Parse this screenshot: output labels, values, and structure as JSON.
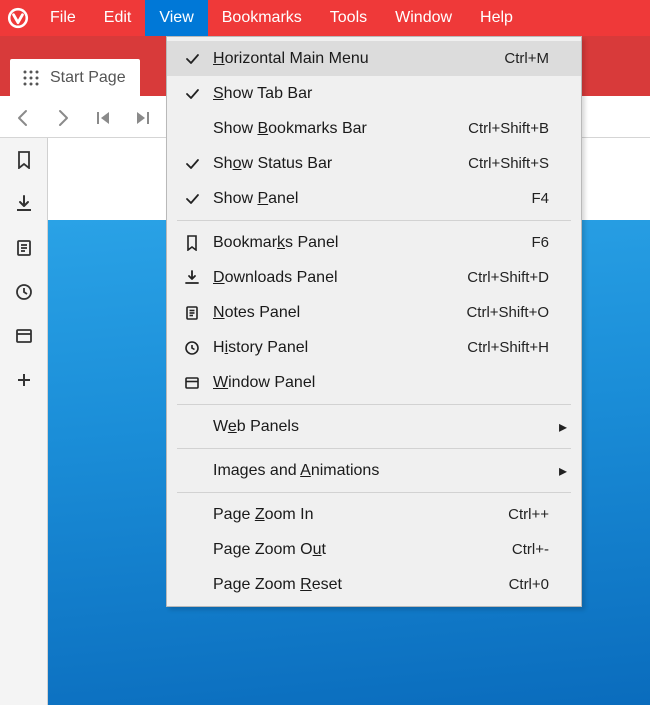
{
  "menubar": {
    "file": "File",
    "edit": "Edit",
    "view": "View",
    "bookmarks": "Bookmarks",
    "tools": "Tools",
    "window": "Window",
    "help": "Help"
  },
  "tab": {
    "title": "Start Page"
  },
  "view_menu": {
    "items": [
      {
        "type": "item",
        "check": true,
        "label_pre": "",
        "ul": "H",
        "label_post": "orizontal Main Menu",
        "shortcut": "Ctrl+M",
        "highlight": true
      },
      {
        "type": "item",
        "check": true,
        "label_pre": "",
        "ul": "S",
        "label_post": "how Tab Bar",
        "shortcut": ""
      },
      {
        "type": "item",
        "check": false,
        "label_pre": "Show ",
        "ul": "B",
        "label_post": "ookmarks Bar",
        "shortcut": "Ctrl+Shift+B"
      },
      {
        "type": "item",
        "check": true,
        "label_pre": "Sh",
        "ul": "o",
        "label_post": "w Status Bar",
        "shortcut": "Ctrl+Shift+S"
      },
      {
        "type": "item",
        "check": true,
        "label_pre": "Show ",
        "ul": "P",
        "label_post": "anel",
        "shortcut": "F4"
      },
      {
        "type": "sep"
      },
      {
        "type": "item",
        "icon": "bookmark",
        "label_pre": "Bookmar",
        "ul": "k",
        "label_post": "s Panel",
        "shortcut": "F6"
      },
      {
        "type": "item",
        "icon": "download",
        "label_pre": "",
        "ul": "D",
        "label_post": "ownloads Panel",
        "shortcut": "Ctrl+Shift+D"
      },
      {
        "type": "item",
        "icon": "notes",
        "label_pre": "",
        "ul": "N",
        "label_post": "otes Panel",
        "shortcut": "Ctrl+Shift+O"
      },
      {
        "type": "item",
        "icon": "history",
        "label_pre": "H",
        "ul": "i",
        "label_post": "story Panel",
        "shortcut": "Ctrl+Shift+H"
      },
      {
        "type": "item",
        "icon": "window",
        "label_pre": "",
        "ul": "W",
        "label_post": "indow Panel",
        "shortcut": ""
      },
      {
        "type": "sep"
      },
      {
        "type": "item",
        "label_pre": "W",
        "ul": "e",
        "label_post": "b Panels",
        "shortcut": "",
        "submenu": true
      },
      {
        "type": "sep"
      },
      {
        "type": "item",
        "label_pre": "Images and ",
        "ul": "A",
        "label_post": "nimations",
        "shortcut": "",
        "submenu": true
      },
      {
        "type": "sep"
      },
      {
        "type": "item",
        "label_pre": "Page ",
        "ul": "Z",
        "label_post": "oom In",
        "shortcut": "Ctrl++"
      },
      {
        "type": "item",
        "label_pre": "Page Zoom O",
        "ul": "u",
        "label_post": "t",
        "shortcut": "Ctrl+-"
      },
      {
        "type": "item",
        "label_pre": "Page Zoom ",
        "ul": "R",
        "label_post": "eset",
        "shortcut": "Ctrl+0"
      }
    ]
  }
}
